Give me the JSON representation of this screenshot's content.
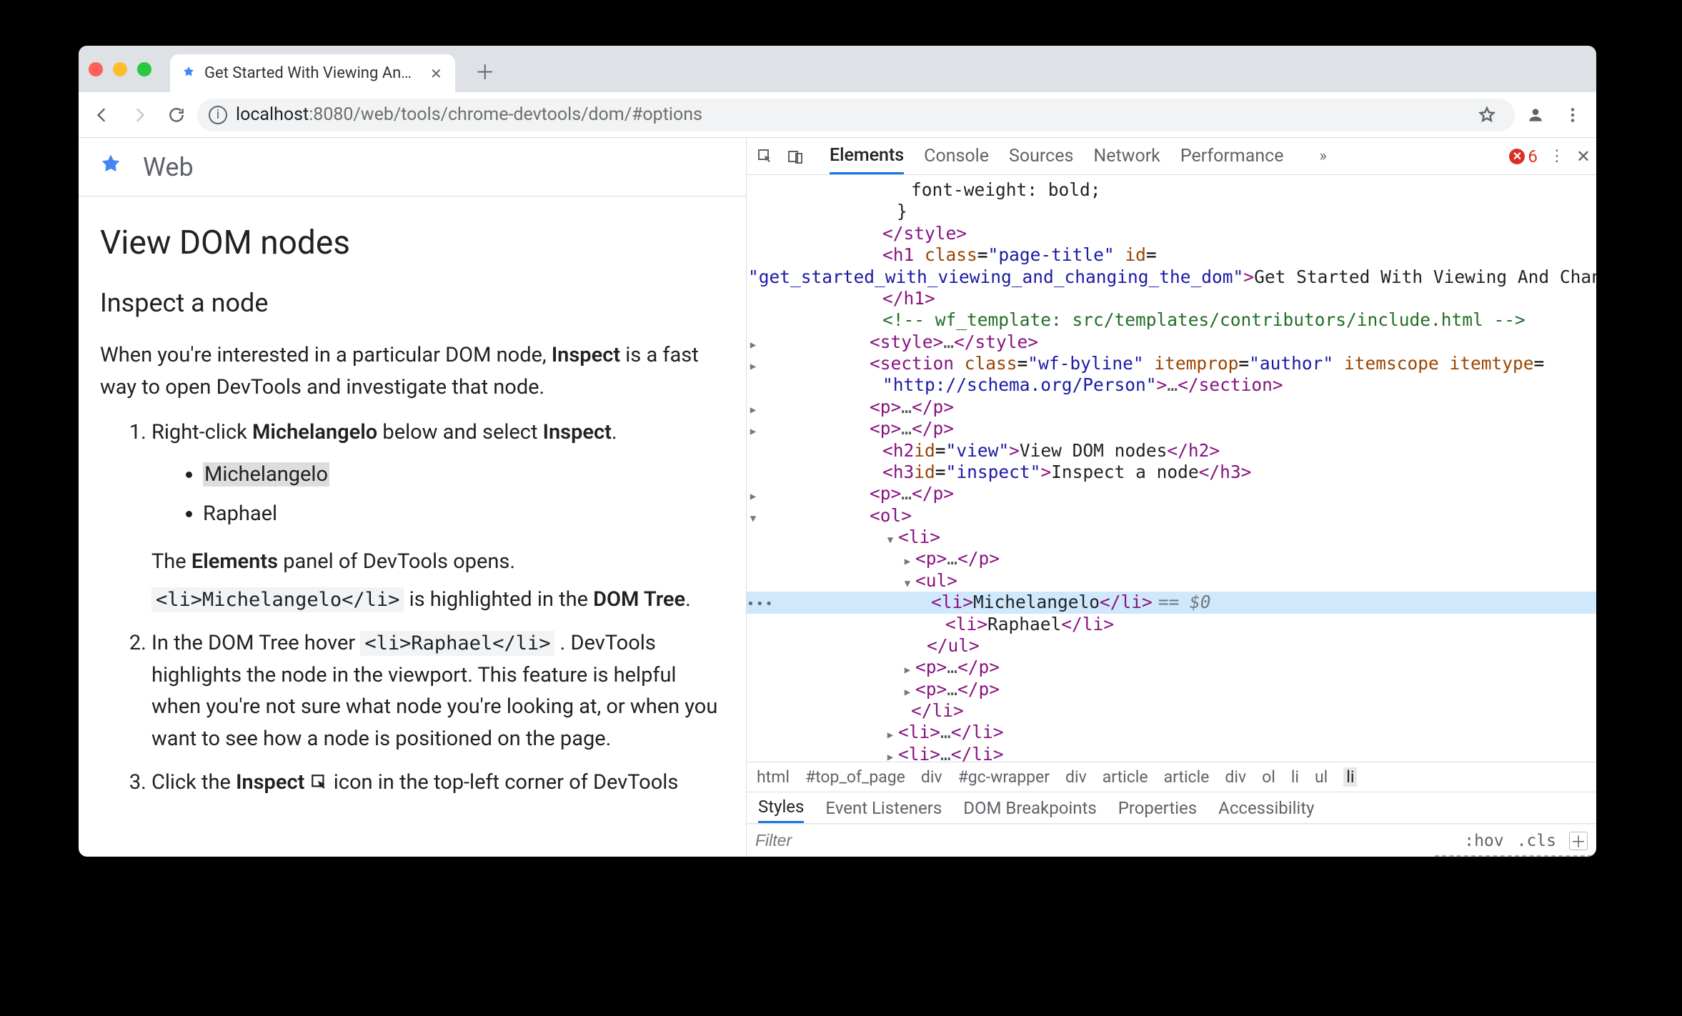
{
  "browser": {
    "tab_title": "Get Started With Viewing And C",
    "url_host": "localhost",
    "url_port": ":8080",
    "url_path": "/web/tools/chrome-devtools/dom/#options"
  },
  "page": {
    "site_label": "Web",
    "h2": "View DOM nodes",
    "h3": "Inspect a node",
    "intro_before": "When you're interested in a particular DOM node, ",
    "intro_bold": "Inspect",
    "intro_after": " is a fast way to open DevTools and investigate that node.",
    "step1_a": "Right-click ",
    "step1_b": "Michelangelo",
    "step1_c": " below and select ",
    "step1_d": "Inspect",
    "step1_e": ".",
    "bullet1": "Michelangelo",
    "bullet2": "Raphael",
    "afterlist_a": "The ",
    "afterlist_b": "Elements",
    "afterlist_c": " panel of DevTools opens.",
    "code1": "<li>Michelangelo</li>",
    "after_code1_a": " is highlighted in the ",
    "after_code1_b": "DOM Tree",
    "after_code1_c": ".",
    "step2_a": "In the DOM Tree hover ",
    "code2": "<li>Raphael</li>",
    "step2_b": ". DevTools highlights the node in the viewport. This feature is helpful when you're not sure what node you're looking at, or when you want to see how a node is positioned on the page.",
    "step3_a": "Click the ",
    "step3_b": "Inspect",
    "step3_c": " icon in the top-left corner of DevTools"
  },
  "devtools": {
    "tabs": [
      "Elements",
      "Console",
      "Sources",
      "Network",
      "Performance"
    ],
    "errors": "6",
    "h1_class": "page-title",
    "h1_id": "get_started_with_viewing_and_changing_the_dom",
    "h1_text": "Get Started With Viewing And Changing The DOM",
    "comment": "<!-- wf_template: src/templates/contributors/include.html -->",
    "section_class": "wf-byline",
    "section_itemprop": "author",
    "section_itemtype": "http://schema.org/Person",
    "h2_id": "view",
    "h2_text": "View DOM nodes",
    "h3_id": "inspect",
    "h3_text": "Inspect a node",
    "li_sel": "Michelangelo",
    "li_other": "Raphael",
    "sel_suffix": "== $0",
    "crumbs": [
      "html",
      "#top_of_page",
      "div",
      "#gc-wrapper",
      "div",
      "article",
      "article",
      "div",
      "ol",
      "li",
      "ul",
      "li"
    ],
    "subtabs": [
      "Styles",
      "Event Listeners",
      "DOM Breakpoints",
      "Properties",
      "Accessibility"
    ],
    "filter_placeholder": "Filter",
    "hov": ":hov",
    "cls": ".cls"
  }
}
